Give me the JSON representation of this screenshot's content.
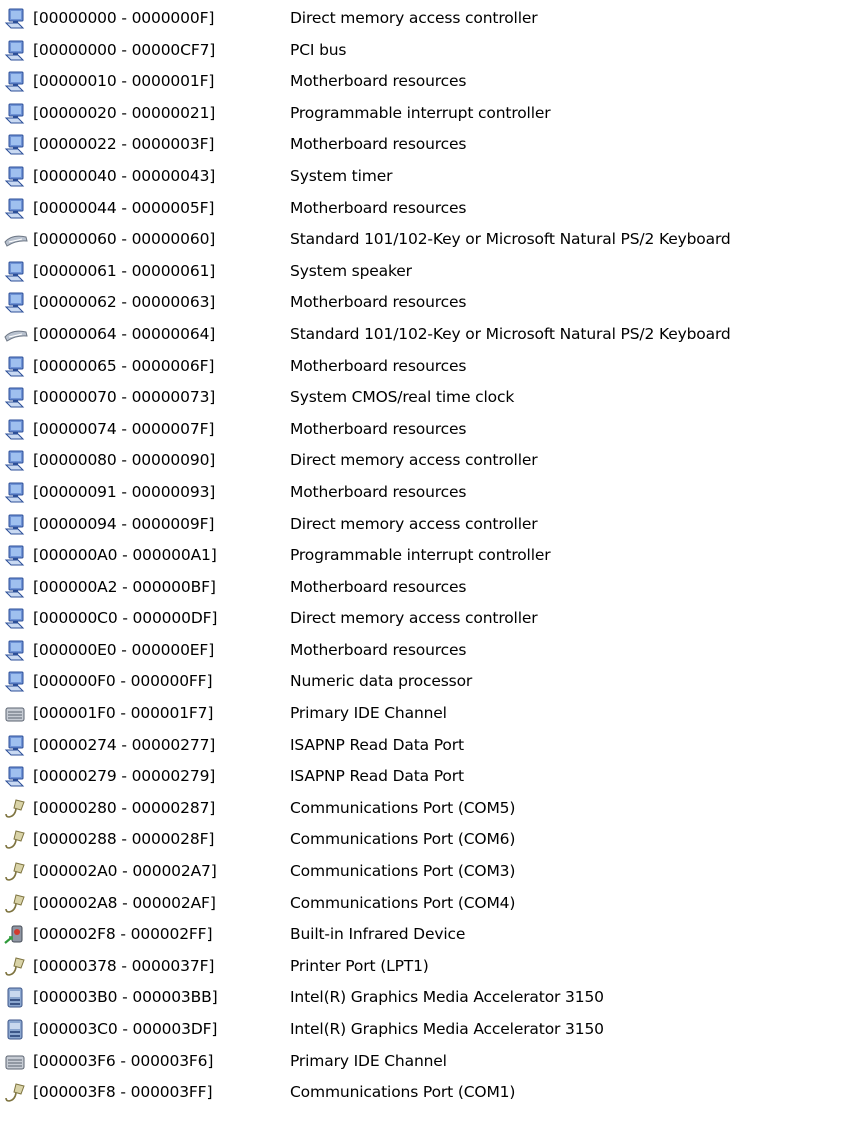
{
  "resources": [
    {
      "range": "[00000000 - 0000000F]",
      "label": "Direct memory access controller",
      "icon": "system-device-icon"
    },
    {
      "range": "[00000000 - 00000CF7]",
      "label": "PCI bus",
      "icon": "system-device-icon"
    },
    {
      "range": "[00000010 - 0000001F]",
      "label": "Motherboard resources",
      "icon": "system-device-icon"
    },
    {
      "range": "[00000020 - 00000021]",
      "label": "Programmable interrupt controller",
      "icon": "system-device-icon"
    },
    {
      "range": "[00000022 - 0000003F]",
      "label": "Motherboard resources",
      "icon": "system-device-icon"
    },
    {
      "range": "[00000040 - 00000043]",
      "label": "System timer",
      "icon": "system-device-icon"
    },
    {
      "range": "[00000044 - 0000005F]",
      "label": "Motherboard resources",
      "icon": "system-device-icon"
    },
    {
      "range": "[00000060 - 00000060]",
      "label": "Standard 101/102-Key or Microsoft Natural PS/2 Keyboard",
      "icon": "keyboard-icon"
    },
    {
      "range": "[00000061 - 00000061]",
      "label": "System speaker",
      "icon": "system-device-icon"
    },
    {
      "range": "[00000062 - 00000063]",
      "label": "Motherboard resources",
      "icon": "system-device-icon"
    },
    {
      "range": "[00000064 - 00000064]",
      "label": "Standard 101/102-Key or Microsoft Natural PS/2 Keyboard",
      "icon": "keyboard-icon"
    },
    {
      "range": "[00000065 - 0000006F]",
      "label": "Motherboard resources",
      "icon": "system-device-icon"
    },
    {
      "range": "[00000070 - 00000073]",
      "label": "System CMOS/real time clock",
      "icon": "system-device-icon"
    },
    {
      "range": "[00000074 - 0000007F]",
      "label": "Motherboard resources",
      "icon": "system-device-icon"
    },
    {
      "range": "[00000080 - 00000090]",
      "label": "Direct memory access controller",
      "icon": "system-device-icon"
    },
    {
      "range": "[00000091 - 00000093]",
      "label": "Motherboard resources",
      "icon": "system-device-icon"
    },
    {
      "range": "[00000094 - 0000009F]",
      "label": "Direct memory access controller",
      "icon": "system-device-icon"
    },
    {
      "range": "[000000A0 - 000000A1]",
      "label": "Programmable interrupt controller",
      "icon": "system-device-icon"
    },
    {
      "range": "[000000A2 - 000000BF]",
      "label": "Motherboard resources",
      "icon": "system-device-icon"
    },
    {
      "range": "[000000C0 - 000000DF]",
      "label": "Direct memory access controller",
      "icon": "system-device-icon"
    },
    {
      "range": "[000000E0 - 000000EF]",
      "label": "Motherboard resources",
      "icon": "system-device-icon"
    },
    {
      "range": "[000000F0 - 000000FF]",
      "label": "Numeric data processor",
      "icon": "system-device-icon"
    },
    {
      "range": "[000001F0 - 000001F7]",
      "label": "Primary IDE Channel",
      "icon": "ide-controller-icon"
    },
    {
      "range": "[00000274 - 00000277]",
      "label": "ISAPNP Read Data Port",
      "icon": "system-device-icon"
    },
    {
      "range": "[00000279 - 00000279]",
      "label": "ISAPNP Read Data Port",
      "icon": "system-device-icon"
    },
    {
      "range": "[00000280 - 00000287]",
      "label": "Communications Port (COM5)",
      "icon": "port-connector-icon"
    },
    {
      "range": "[00000288 - 0000028F]",
      "label": "Communications Port (COM6)",
      "icon": "port-connector-icon"
    },
    {
      "range": "[000002A0 - 000002A7]",
      "label": "Communications Port (COM3)",
      "icon": "port-connector-icon"
    },
    {
      "range": "[000002A8 - 000002AF]",
      "label": "Communications Port (COM4)",
      "icon": "port-connector-icon"
    },
    {
      "range": "[000002F8 - 000002FF]",
      "label": "Built-in Infrared Device",
      "icon": "infrared-device-icon"
    },
    {
      "range": "[00000378 - 0000037F]",
      "label": "Printer Port (LPT1)",
      "icon": "port-connector-icon"
    },
    {
      "range": "[000003B0 - 000003BB]",
      "label": "Intel(R) Graphics Media Accelerator 3150",
      "icon": "display-adapter-icon"
    },
    {
      "range": "[000003C0 - 000003DF]",
      "label": "Intel(R) Graphics Media Accelerator 3150",
      "icon": "display-adapter-icon"
    },
    {
      "range": "[000003F6 - 000003F6]",
      "label": "Primary IDE Channel",
      "icon": "ide-controller-icon"
    },
    {
      "range": "[000003F8 - 000003FF]",
      "label": "Communications Port (COM1)",
      "icon": "port-connector-icon"
    }
  ]
}
